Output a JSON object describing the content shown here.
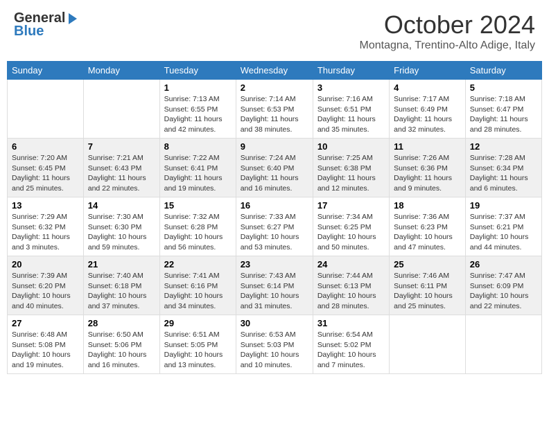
{
  "header": {
    "logo_general": "General",
    "logo_blue": "Blue",
    "month_title": "October 2024",
    "location": "Montagna, Trentino-Alto Adige, Italy"
  },
  "days_of_week": [
    "Sunday",
    "Monday",
    "Tuesday",
    "Wednesday",
    "Thursday",
    "Friday",
    "Saturday"
  ],
  "weeks": [
    [
      {
        "day": "",
        "info": ""
      },
      {
        "day": "",
        "info": ""
      },
      {
        "day": "1",
        "sunrise": "7:13 AM",
        "sunset": "6:55 PM",
        "daylight": "11 hours and 42 minutes."
      },
      {
        "day": "2",
        "sunrise": "7:14 AM",
        "sunset": "6:53 PM",
        "daylight": "11 hours and 38 minutes."
      },
      {
        "day": "3",
        "sunrise": "7:16 AM",
        "sunset": "6:51 PM",
        "daylight": "11 hours and 35 minutes."
      },
      {
        "day": "4",
        "sunrise": "7:17 AM",
        "sunset": "6:49 PM",
        "daylight": "11 hours and 32 minutes."
      },
      {
        "day": "5",
        "sunrise": "7:18 AM",
        "sunset": "6:47 PM",
        "daylight": "11 hours and 28 minutes."
      }
    ],
    [
      {
        "day": "6",
        "sunrise": "7:20 AM",
        "sunset": "6:45 PM",
        "daylight": "11 hours and 25 minutes."
      },
      {
        "day": "7",
        "sunrise": "7:21 AM",
        "sunset": "6:43 PM",
        "daylight": "11 hours and 22 minutes."
      },
      {
        "day": "8",
        "sunrise": "7:22 AM",
        "sunset": "6:41 PM",
        "daylight": "11 hours and 19 minutes."
      },
      {
        "day": "9",
        "sunrise": "7:24 AM",
        "sunset": "6:40 PM",
        "daylight": "11 hours and 16 minutes."
      },
      {
        "day": "10",
        "sunrise": "7:25 AM",
        "sunset": "6:38 PM",
        "daylight": "11 hours and 12 minutes."
      },
      {
        "day": "11",
        "sunrise": "7:26 AM",
        "sunset": "6:36 PM",
        "daylight": "11 hours and 9 minutes."
      },
      {
        "day": "12",
        "sunrise": "7:28 AM",
        "sunset": "6:34 PM",
        "daylight": "11 hours and 6 minutes."
      }
    ],
    [
      {
        "day": "13",
        "sunrise": "7:29 AM",
        "sunset": "6:32 PM",
        "daylight": "11 hours and 3 minutes."
      },
      {
        "day": "14",
        "sunrise": "7:30 AM",
        "sunset": "6:30 PM",
        "daylight": "10 hours and 59 minutes."
      },
      {
        "day": "15",
        "sunrise": "7:32 AM",
        "sunset": "6:28 PM",
        "daylight": "10 hours and 56 minutes."
      },
      {
        "day": "16",
        "sunrise": "7:33 AM",
        "sunset": "6:27 PM",
        "daylight": "10 hours and 53 minutes."
      },
      {
        "day": "17",
        "sunrise": "7:34 AM",
        "sunset": "6:25 PM",
        "daylight": "10 hours and 50 minutes."
      },
      {
        "day": "18",
        "sunrise": "7:36 AM",
        "sunset": "6:23 PM",
        "daylight": "10 hours and 47 minutes."
      },
      {
        "day": "19",
        "sunrise": "7:37 AM",
        "sunset": "6:21 PM",
        "daylight": "10 hours and 44 minutes."
      }
    ],
    [
      {
        "day": "20",
        "sunrise": "7:39 AM",
        "sunset": "6:20 PM",
        "daylight": "10 hours and 40 minutes."
      },
      {
        "day": "21",
        "sunrise": "7:40 AM",
        "sunset": "6:18 PM",
        "daylight": "10 hours and 37 minutes."
      },
      {
        "day": "22",
        "sunrise": "7:41 AM",
        "sunset": "6:16 PM",
        "daylight": "10 hours and 34 minutes."
      },
      {
        "day": "23",
        "sunrise": "7:43 AM",
        "sunset": "6:14 PM",
        "daylight": "10 hours and 31 minutes."
      },
      {
        "day": "24",
        "sunrise": "7:44 AM",
        "sunset": "6:13 PM",
        "daylight": "10 hours and 28 minutes."
      },
      {
        "day": "25",
        "sunrise": "7:46 AM",
        "sunset": "6:11 PM",
        "daylight": "10 hours and 25 minutes."
      },
      {
        "day": "26",
        "sunrise": "7:47 AM",
        "sunset": "6:09 PM",
        "daylight": "10 hours and 22 minutes."
      }
    ],
    [
      {
        "day": "27",
        "sunrise": "6:48 AM",
        "sunset": "5:08 PM",
        "daylight": "10 hours and 19 minutes."
      },
      {
        "day": "28",
        "sunrise": "6:50 AM",
        "sunset": "5:06 PM",
        "daylight": "10 hours and 16 minutes."
      },
      {
        "day": "29",
        "sunrise": "6:51 AM",
        "sunset": "5:05 PM",
        "daylight": "10 hours and 13 minutes."
      },
      {
        "day": "30",
        "sunrise": "6:53 AM",
        "sunset": "5:03 PM",
        "daylight": "10 hours and 10 minutes."
      },
      {
        "day": "31",
        "sunrise": "6:54 AM",
        "sunset": "5:02 PM",
        "daylight": "10 hours and 7 minutes."
      },
      {
        "day": "",
        "info": ""
      },
      {
        "day": "",
        "info": ""
      }
    ]
  ]
}
